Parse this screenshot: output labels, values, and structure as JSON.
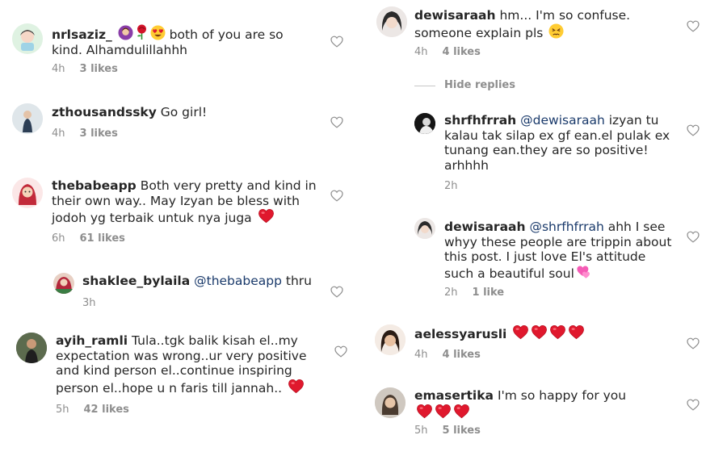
{
  "left": [
    {
      "username": "nrlsaziz_",
      "text_after_emoji": "both of you are so kind. Alhamdulillahhh",
      "time": "4h",
      "likes": "3 likes"
    },
    {
      "username": "zthousandssky",
      "text": "Go girl!",
      "time": "4h",
      "likes": "3 likes"
    },
    {
      "username": "thebabeapp",
      "text": "Both very pretty and kind in their own way.. May Izyan be bless with jodoh yg terbaik untuk nya juga",
      "time": "6h",
      "likes": "61 likes"
    },
    {
      "username": "shaklee_bylaila",
      "mention": "@thebabeapp",
      "text": "thru",
      "time": "3h"
    },
    {
      "username": "ayih_ramli",
      "text": "Tula..tgk balik kisah el..my expectation was wrong..ur very positive and kind person el..continue inspiring person el..hope u n faris till jannah..",
      "time": "5h",
      "likes": "42 likes"
    }
  ],
  "right": [
    {
      "username": "dewisaraah",
      "text_line1": "hm... I'm so confuse.",
      "text_line2": "someone explain pls",
      "time": "4h",
      "likes": "4 likes"
    },
    {
      "hide_replies": "Hide replies"
    },
    {
      "username": "shrfhfrrah",
      "mention": "@dewisaraah",
      "text": "izyan tu kalau tak silap ex gf ean.el pulak ex tunang ean.they are so positive! arhhhh",
      "time": "2h"
    },
    {
      "username": "dewisaraah",
      "mention": "@shrfhfrrah",
      "text": "ahh I see whyy these people are trippin about this post. I just love El's attitude such a beautiful soul",
      "time": "2h",
      "likes": "1 like"
    },
    {
      "username": "aelessyarusli",
      "time": "4h",
      "likes": "4 likes"
    },
    {
      "username": "emasertika",
      "text": "I'm so happy for you",
      "time": "5h",
      "likes": "5 likes"
    }
  ]
}
